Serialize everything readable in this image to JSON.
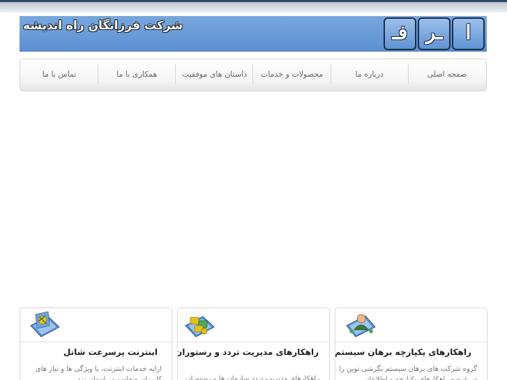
{
  "header": {
    "company_name": "شرکت فرزانگان راه اندیشه",
    "logo_letters": [
      "فـ",
      "ـر",
      "ا"
    ]
  },
  "nav": {
    "items": [
      {
        "label": "صفحه اصلی"
      },
      {
        "label": "درباره ما"
      },
      {
        "label": "محصولات و خدمات"
      },
      {
        "label": "داستان های موفقیت"
      },
      {
        "label": "همکاری با ما"
      },
      {
        "label": "تماس با ما"
      }
    ]
  },
  "boxes": [
    {
      "title": "راهکارهای یکپارچه برهان سیستم",
      "text": "گروه شرکت های برهان سیستم نگرشی نوین را در عرصه راهکارهای یکپارچه و اطلاعاتی",
      "icon": "user-network-icon"
    },
    {
      "title": "راهکارهای مدیریت تردد و رستوران",
      "text": "راهکارهای مدیریت تردد سازمان ها و رستوران",
      "icon": "puzzle-network-icon"
    },
    {
      "title": "اینترنت پرسرعت شاتل",
      "text": "ارایه خدمات اینترنت، با ویژگی ها و نیاز های کاربران متفاوت در استان یزد",
      "icon": "globe-network-icon"
    }
  ],
  "colors": {
    "header_blue": "#5b90d3",
    "topbar_dark": "#2d4966"
  }
}
